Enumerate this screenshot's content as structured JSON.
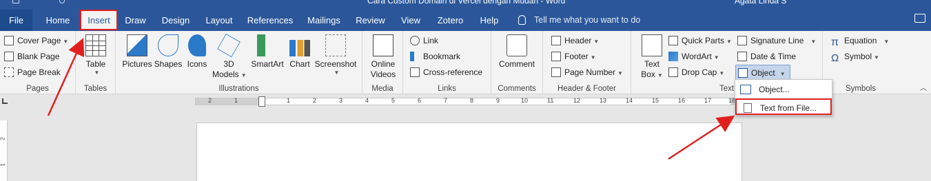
{
  "title_bar": {
    "title": "Cara Custom Domain di Vercel dengan Mudah - Word",
    "user": "Agata Linda S"
  },
  "tabs": [
    "File",
    "Home",
    "Insert",
    "Draw",
    "Design",
    "Layout",
    "References",
    "Mailings",
    "Review",
    "View",
    "Zotero",
    "Help"
  ],
  "active_tab": "Insert",
  "tell_me": "Tell me what you want to do",
  "groups": {
    "pages": {
      "label": "Pages",
      "items": [
        "Cover Page",
        "Blank Page",
        "Page Break"
      ]
    },
    "tables": {
      "label": "Tables",
      "table": "Table"
    },
    "illustrations": {
      "label": "Illustrations",
      "items": [
        "Pictures",
        "Shapes",
        "Icons",
        "3D",
        "Models",
        "SmartArt",
        "Chart",
        "Screenshot"
      ]
    },
    "media": {
      "label": "Media",
      "online": "Online",
      "videos": "Videos"
    },
    "links": {
      "label": "Links",
      "items": [
        "Link",
        "Bookmark",
        "Cross-reference"
      ]
    },
    "comments": {
      "label": "Comments",
      "comment": "Comment"
    },
    "header_footer": {
      "label": "Header & Footer",
      "items": [
        "Header",
        "Footer",
        "Page Number"
      ]
    },
    "text": {
      "label": "Text",
      "text_box_1": "Text",
      "text_box_2": "Box",
      "items": [
        "Quick Parts",
        "WordArt",
        "Drop Cap",
        "Signature Line",
        "Date & Time",
        "Object"
      ]
    },
    "symbols": {
      "label": "Symbols",
      "items": [
        "Equation",
        "Symbol"
      ]
    }
  },
  "ruler": {
    "numbers": [
      "2",
      "1",
      "1",
      "2",
      "3",
      "4",
      "5",
      "6",
      "7",
      "8",
      "9",
      "10",
      "11",
      "12",
      "13",
      "14",
      "15",
      "16",
      "17",
      "18"
    ],
    "vertical": [
      "2",
      "1"
    ]
  },
  "object_menu": {
    "items": [
      "Object...",
      "Text from File..."
    ]
  },
  "colors": {
    "accent": "#2b579a",
    "highlight": "#e0201f"
  }
}
